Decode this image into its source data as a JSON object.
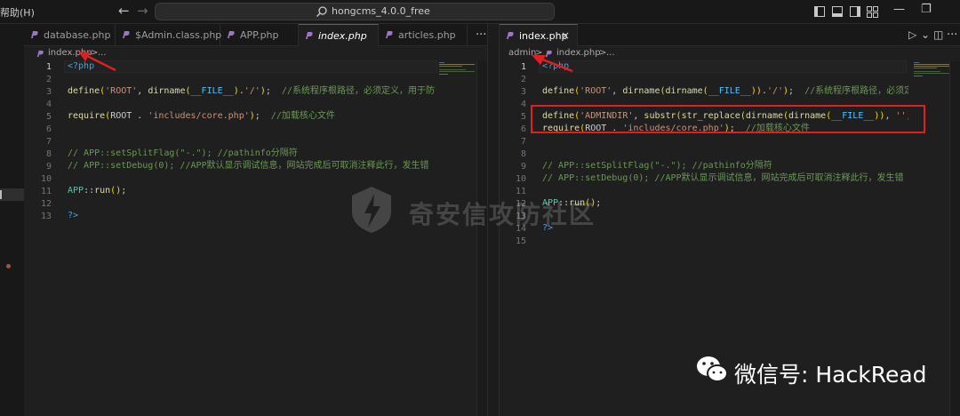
{
  "titlebar": {
    "menu_help": "帮助(H)",
    "back_arrow": "←",
    "forward_arrow": "→",
    "command_center_text": "hongcms_4.0.0_free",
    "minimize": "—",
    "restore": "❐"
  },
  "left_group": {
    "tabs": [
      {
        "label": "database.php",
        "active": false,
        "italic": false
      },
      {
        "label": "$Admin.class.php",
        "active": false,
        "italic": false
      },
      {
        "label": "APP.php",
        "active": false,
        "italic": false
      },
      {
        "label": "index.php",
        "active": true,
        "italic": true
      },
      {
        "label": "articles.php",
        "active": false,
        "italic": false
      }
    ],
    "more": "···",
    "breadcrumb": {
      "file": "index.php",
      "sep": ">",
      "rest": "..."
    },
    "line_numbers": [
      "1",
      "2",
      "3",
      "4",
      "5",
      "6",
      "7",
      "8",
      "9",
      "10",
      "11",
      "12",
      "13"
    ],
    "current_line": "1"
  },
  "right_group": {
    "tabs": [
      {
        "label": "index.php",
        "active": true,
        "close": "×"
      }
    ],
    "run_icon": "▷",
    "run_dropdown": "⌄",
    "split_icon": "◫",
    "more": "···",
    "breadcrumb": {
      "folder": "admin",
      "sep1": ">",
      "file": "index.php",
      "sep2": ">",
      "rest": "..."
    },
    "line_numbers": [
      "1",
      "2",
      "3",
      "4",
      "5",
      "6",
      "7",
      "8",
      "9",
      "10",
      "11",
      "12",
      "13",
      "14",
      "15"
    ],
    "current_line": "1"
  },
  "watermarks": {
    "center": "奇安信攻防社区",
    "bottom_right": "微信号: HackRead"
  },
  "colors": {
    "editor_bg": "#1f1f1f",
    "accent": "#0078d4",
    "annotation": "#e02020"
  }
}
